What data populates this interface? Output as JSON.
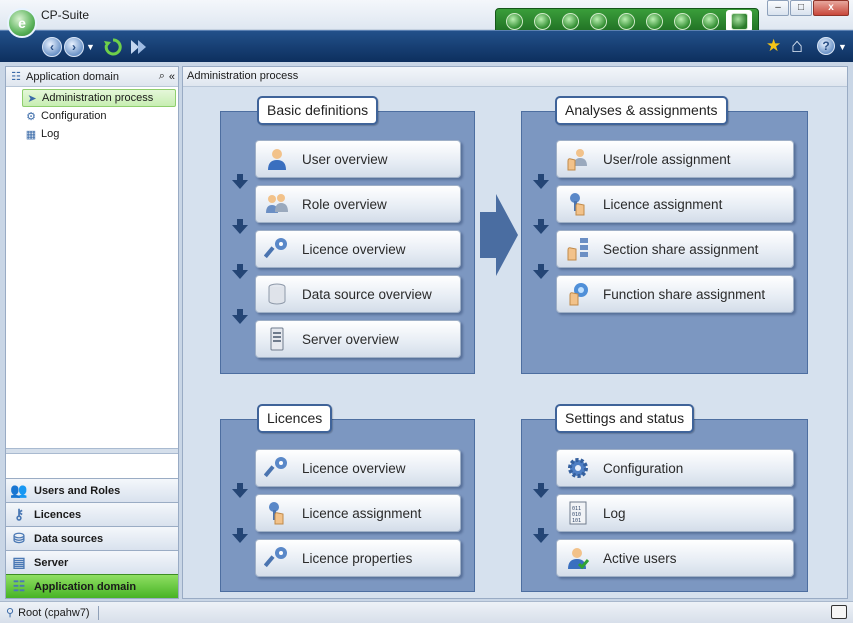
{
  "window": {
    "title": "CP-Suite",
    "btn_min": "–",
    "btn_max": "□",
    "btn_close": "x"
  },
  "modules": [
    "module-1",
    "module-2",
    "module-3",
    "module-4",
    "module-5",
    "module-6",
    "module-7",
    "module-8",
    "module-9-active"
  ],
  "toolbar": {
    "back_icon": "back-arrow-icon",
    "forward_icon": "forward-arrow-icon",
    "refresh_icon": "refresh-icon",
    "skip_icon": "skip-forward-icon",
    "star": "★",
    "home": "⌂",
    "help": "?"
  },
  "left_pane": {
    "header": "Application domain",
    "tree": [
      {
        "label": "Administration process",
        "icon": "process-icon"
      },
      {
        "label": "Configuration",
        "icon": "gear-icon"
      },
      {
        "label": "Log",
        "icon": "log-icon"
      }
    ],
    "nav": [
      {
        "label": "Users and Roles",
        "icon": "users-icon"
      },
      {
        "label": "Licences",
        "icon": "key-icon"
      },
      {
        "label": "Data sources",
        "icon": "database-icon"
      },
      {
        "label": "Server",
        "icon": "server-icon"
      },
      {
        "label": "Application domain",
        "icon": "domain-icon"
      }
    ]
  },
  "content": {
    "header": "Administration process",
    "basic": {
      "title": "Basic definitions",
      "items": [
        "User overview",
        "Role overview",
        "Licence overview",
        "Data source overview",
        "Server overview"
      ]
    },
    "analyses": {
      "title": "Analyses & assignments",
      "items": [
        "User/role assignment",
        "Licence assignment",
        "Section share assignment",
        "Function share assignment"
      ]
    },
    "licences": {
      "title": "Licences",
      "items": [
        "Licence overview",
        "Licence assignment",
        "Licence properties"
      ]
    },
    "settings": {
      "title": "Settings and status",
      "items": [
        "Configuration",
        "Log",
        "Active users"
      ]
    }
  },
  "status": {
    "user": "Root (cpahw7)"
  },
  "colors": {
    "accent_green": "#47b324",
    "panel_blue": "#7c97c1",
    "toolbar_blue": "#0d2f5e"
  }
}
